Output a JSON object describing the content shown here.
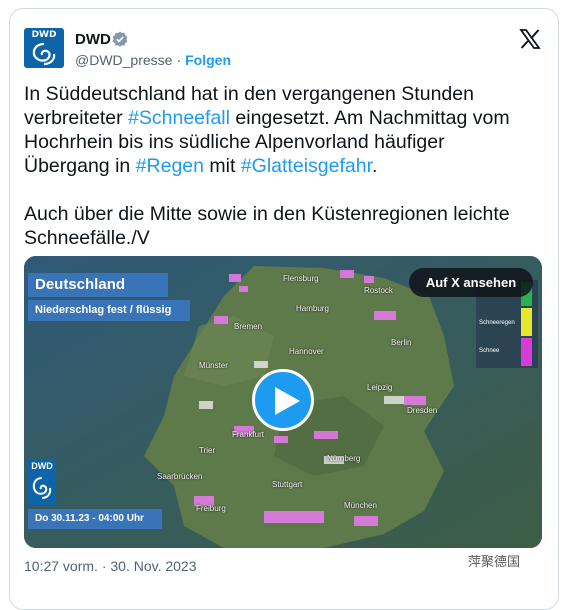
{
  "author": {
    "name": "DWD",
    "handle": "@DWD_presse",
    "separator": "·",
    "follow_label": "Folgen",
    "avatar_text": "DWD",
    "verified": true
  },
  "tweet": {
    "p1": [
      {
        "t": "In Süddeutschland hat in den vergangenen Stunden verbreiteter ",
        "tag": false
      },
      {
        "t": "#Schneefall",
        "tag": true
      },
      {
        "t": " eingesetzt. Am Nachmittag vom Hochrhein bis ins südliche Alpenvorland häufiger Übergang in ",
        "tag": false
      },
      {
        "t": "#Regen",
        "tag": true
      },
      {
        "t": " mit ",
        "tag": false
      },
      {
        "t": "#Glatteisgefahr",
        "tag": true
      },
      {
        "t": ".",
        "tag": false
      }
    ],
    "p2": "Auch über die Mitte sowie in den Küstenregionen leichte Schneefälle./V"
  },
  "media": {
    "title": "Deutschland",
    "subtitle": "Niederschlag fest / flüssig",
    "watch_label": "Auf X ansehen",
    "date_label": "Do 30.11.23 - 04:00 Uhr",
    "logo_text": "DWD",
    "legend": [
      "Schneeregen",
      "Schnee"
    ],
    "cities": [
      "Flensburg",
      "Rostock",
      "Hamburg",
      "Bremen",
      "Berlin",
      "Hannover",
      "Münster",
      "Leipzig",
      "Dresden",
      "Frankfurt",
      "Trier",
      "Nürnberg",
      "Saarbrücken",
      "Stuttgart",
      "Freiburg",
      "München"
    ]
  },
  "timestamp": "10:27 vorm. · 30. Nov. 2023",
  "watermark": "萍聚德国",
  "colors": {
    "link": "#1d9bf0",
    "brand": "#0d64a8",
    "tv_blue": "#3a74b8",
    "snow": "#e27ae6"
  }
}
